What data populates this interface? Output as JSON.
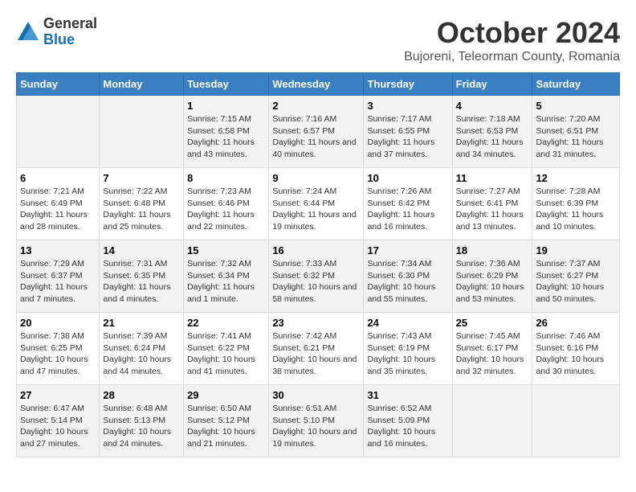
{
  "header": {
    "logo_general": "General",
    "logo_blue": "Blue",
    "month_title": "October 2024",
    "subtitle": "Bujoreni, Teleorman County, Romania"
  },
  "weekdays": [
    "Sunday",
    "Monday",
    "Tuesday",
    "Wednesday",
    "Thursday",
    "Friday",
    "Saturday"
  ],
  "weeks": [
    [
      {
        "day": "",
        "info": ""
      },
      {
        "day": "",
        "info": ""
      },
      {
        "day": "1",
        "info": "Sunrise: 7:15 AM\nSunset: 6:58 PM\nDaylight: 11 hours and 43 minutes."
      },
      {
        "day": "2",
        "info": "Sunrise: 7:16 AM\nSunset: 6:57 PM\nDaylight: 11 hours and 40 minutes."
      },
      {
        "day": "3",
        "info": "Sunrise: 7:17 AM\nSunset: 6:55 PM\nDaylight: 11 hours and 37 minutes."
      },
      {
        "day": "4",
        "info": "Sunrise: 7:18 AM\nSunset: 6:53 PM\nDaylight: 11 hours and 34 minutes."
      },
      {
        "day": "5",
        "info": "Sunrise: 7:20 AM\nSunset: 6:51 PM\nDaylight: 11 hours and 31 minutes."
      }
    ],
    [
      {
        "day": "6",
        "info": "Sunrise: 7:21 AM\nSunset: 6:49 PM\nDaylight: 11 hours and 28 minutes."
      },
      {
        "day": "7",
        "info": "Sunrise: 7:22 AM\nSunset: 6:48 PM\nDaylight: 11 hours and 25 minutes."
      },
      {
        "day": "8",
        "info": "Sunrise: 7:23 AM\nSunset: 6:46 PM\nDaylight: 11 hours and 22 minutes."
      },
      {
        "day": "9",
        "info": "Sunrise: 7:24 AM\nSunset: 6:44 PM\nDaylight: 11 hours and 19 minutes."
      },
      {
        "day": "10",
        "info": "Sunrise: 7:26 AM\nSunset: 6:42 PM\nDaylight: 11 hours and 16 minutes."
      },
      {
        "day": "11",
        "info": "Sunrise: 7:27 AM\nSunset: 6:41 PM\nDaylight: 11 hours and 13 minutes."
      },
      {
        "day": "12",
        "info": "Sunrise: 7:28 AM\nSunset: 6:39 PM\nDaylight: 11 hours and 10 minutes."
      }
    ],
    [
      {
        "day": "13",
        "info": "Sunrise: 7:29 AM\nSunset: 6:37 PM\nDaylight: 11 hours and 7 minutes."
      },
      {
        "day": "14",
        "info": "Sunrise: 7:31 AM\nSunset: 6:35 PM\nDaylight: 11 hours and 4 minutes."
      },
      {
        "day": "15",
        "info": "Sunrise: 7:32 AM\nSunset: 6:34 PM\nDaylight: 11 hours and 1 minute."
      },
      {
        "day": "16",
        "info": "Sunrise: 7:33 AM\nSunset: 6:32 PM\nDaylight: 10 hours and 58 minutes."
      },
      {
        "day": "17",
        "info": "Sunrise: 7:34 AM\nSunset: 6:30 PM\nDaylight: 10 hours and 55 minutes."
      },
      {
        "day": "18",
        "info": "Sunrise: 7:36 AM\nSunset: 6:29 PM\nDaylight: 10 hours and 53 minutes."
      },
      {
        "day": "19",
        "info": "Sunrise: 7:37 AM\nSunset: 6:27 PM\nDaylight: 10 hours and 50 minutes."
      }
    ],
    [
      {
        "day": "20",
        "info": "Sunrise: 7:38 AM\nSunset: 6:25 PM\nDaylight: 10 hours and 47 minutes."
      },
      {
        "day": "21",
        "info": "Sunrise: 7:39 AM\nSunset: 6:24 PM\nDaylight: 10 hours and 44 minutes."
      },
      {
        "day": "22",
        "info": "Sunrise: 7:41 AM\nSunset: 6:22 PM\nDaylight: 10 hours and 41 minutes."
      },
      {
        "day": "23",
        "info": "Sunrise: 7:42 AM\nSunset: 6:21 PM\nDaylight: 10 hours and 38 minutes."
      },
      {
        "day": "24",
        "info": "Sunrise: 7:43 AM\nSunset: 6:19 PM\nDaylight: 10 hours and 35 minutes."
      },
      {
        "day": "25",
        "info": "Sunrise: 7:45 AM\nSunset: 6:17 PM\nDaylight: 10 hours and 32 minutes."
      },
      {
        "day": "26",
        "info": "Sunrise: 7:46 AM\nSunset: 6:16 PM\nDaylight: 10 hours and 30 minutes."
      }
    ],
    [
      {
        "day": "27",
        "info": "Sunrise: 6:47 AM\nSunset: 5:14 PM\nDaylight: 10 hours and 27 minutes."
      },
      {
        "day": "28",
        "info": "Sunrise: 6:48 AM\nSunset: 5:13 PM\nDaylight: 10 hours and 24 minutes."
      },
      {
        "day": "29",
        "info": "Sunrise: 6:50 AM\nSunset: 5:12 PM\nDaylight: 10 hours and 21 minutes."
      },
      {
        "day": "30",
        "info": "Sunrise: 6:51 AM\nSunset: 5:10 PM\nDaylight: 10 hours and 19 minutes."
      },
      {
        "day": "31",
        "info": "Sunrise: 6:52 AM\nSunset: 5:09 PM\nDaylight: 10 hours and 16 minutes."
      },
      {
        "day": "",
        "info": ""
      },
      {
        "day": "",
        "info": ""
      }
    ]
  ]
}
